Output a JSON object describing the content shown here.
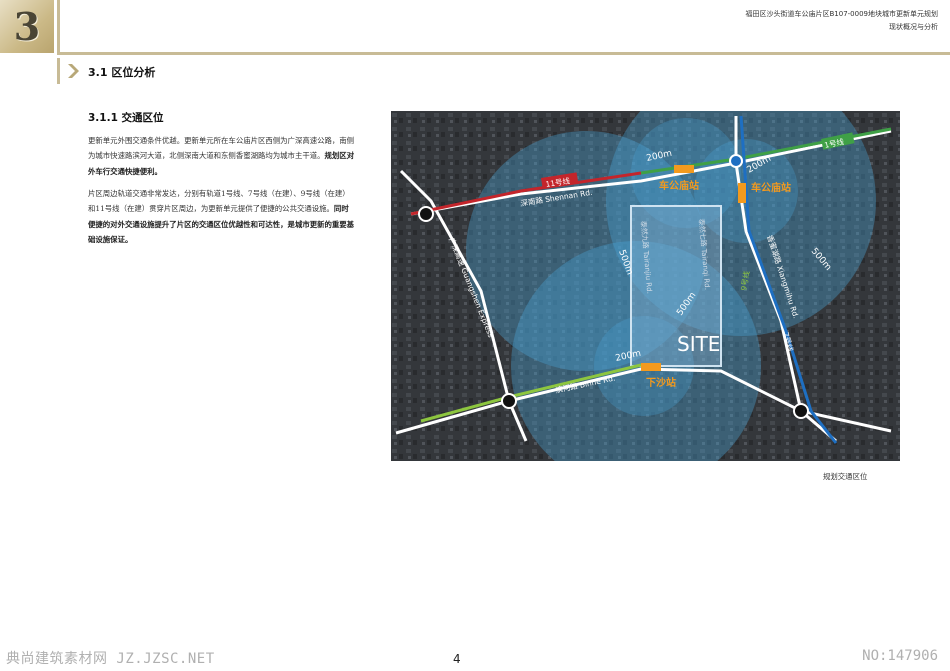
{
  "header": {
    "chapter_number": "3",
    "project_title": "福田区沙头街道车公庙片区B107-0009地块城市更新单元规划",
    "section_subtitle": "现状概况与分析"
  },
  "section": {
    "title": "3.1  区位分析",
    "subsection_title": "3.1.1  交通区位"
  },
  "paragraphs": {
    "p1_normal": "更新单元外围交通条件优越。更新单元所在车公庙片区西侧为广深高速公路，南侧为城市快速路滨河大道，北侧深南大道和东侧香蜜湖路均为城市主干道。",
    "p1_bold": "规划区对外车行交通快捷便利。",
    "p2_normal": "片区周边轨道交通非常发达，分别有轨道1号线、7号线（在建）、9号线（在建）和11号线（在建）贯穿片区周边，为更新单元提供了便捷的公共交通设施。",
    "p2_bold": "同时便捷的对外交通设施提升了片区的交通区位优越性和可达性，是城市更新的重要基础设施保证。"
  },
  "map": {
    "site_label": "SITE",
    "stations": [
      "车公庙站",
      "车公庙站",
      "下沙站"
    ],
    "roads": [
      "深南路  Shennan Rd.",
      "广深高速  Guangshen Express",
      "滨河路  Binhe Rd.",
      "香蜜湖路  Xiangmihu Rd.",
      "泰然九路  Tairanjiu Rd.",
      "泰然七路  Tairanqi Rd."
    ],
    "metro_lines": [
      "11号线",
      "1号线",
      "9号线",
      "7号线"
    ],
    "radius_labels": [
      "200m",
      "200m",
      "200m",
      "500m",
      "500m",
      "500m"
    ],
    "caption": "规划交通区位",
    "colors": {
      "line_11": "#c4252b",
      "line_1": "#3fa046",
      "line_9": "#8dc63f",
      "line_7": "#1e6fc2",
      "station": "#f39a1e",
      "circle": "#4aa3d6"
    }
  },
  "footer": {
    "watermark": "典尚建筑素材网 JZ.JZSC.NET",
    "page_number": "4",
    "id": "NO:147906"
  }
}
